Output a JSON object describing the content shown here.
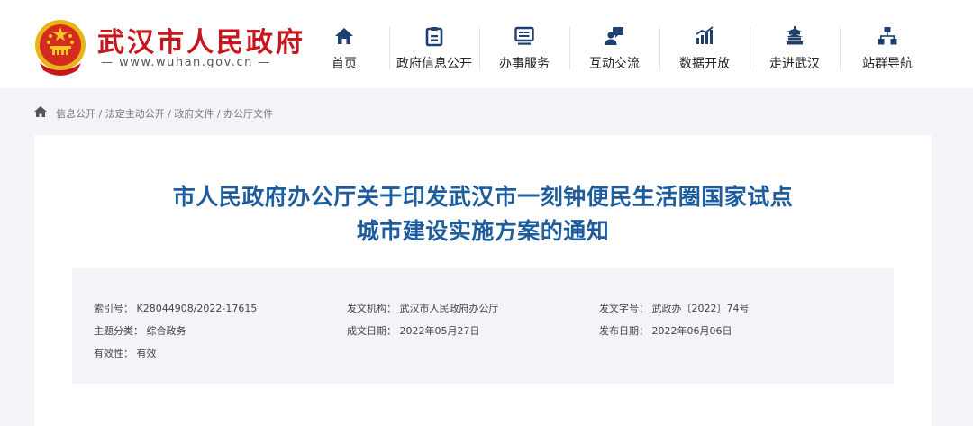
{
  "header": {
    "site_name": "武汉市人民政府",
    "site_url": "— www.wuhan.gov.cn —"
  },
  "nav": [
    {
      "label": "首页",
      "icon": "home-icon"
    },
    {
      "label": "政府信息公开",
      "icon": "document-icon"
    },
    {
      "label": "办事服务",
      "icon": "service-icon"
    },
    {
      "label": "互动交流",
      "icon": "chat-icon"
    },
    {
      "label": "数据开放",
      "icon": "chart-icon"
    },
    {
      "label": "走进武汉",
      "icon": "pavilion-icon"
    },
    {
      "label": "站群导航",
      "icon": "sitemap-icon"
    }
  ],
  "breadcrumb": {
    "text": "信息公开 / 法定主动公开 / 政府文件 / 办公厅文件"
  },
  "article": {
    "title_line1": "市人民政府办公厅关于印发武汉市一刻钟便民生活圈国家试点",
    "title_line2": "城市建设实施方案的通知"
  },
  "meta": {
    "index_no": "索引号：  K28044908/2022-17615",
    "issuer": "发文机构：  武汉市人民政府办公厅",
    "doc_no": "发文字号：  武政办〔2022〕74号",
    "category": "主题分类：  综合政务",
    "created_date": "成文日期：  2022年05月27日",
    "publish_date": "发布日期：  2022年06月06日",
    "validity": "有效性：  有效"
  },
  "colors": {
    "brand_red": "#c8161d",
    "title_blue": "#1f5c9e",
    "icon_navy": "#1d3f72"
  }
}
